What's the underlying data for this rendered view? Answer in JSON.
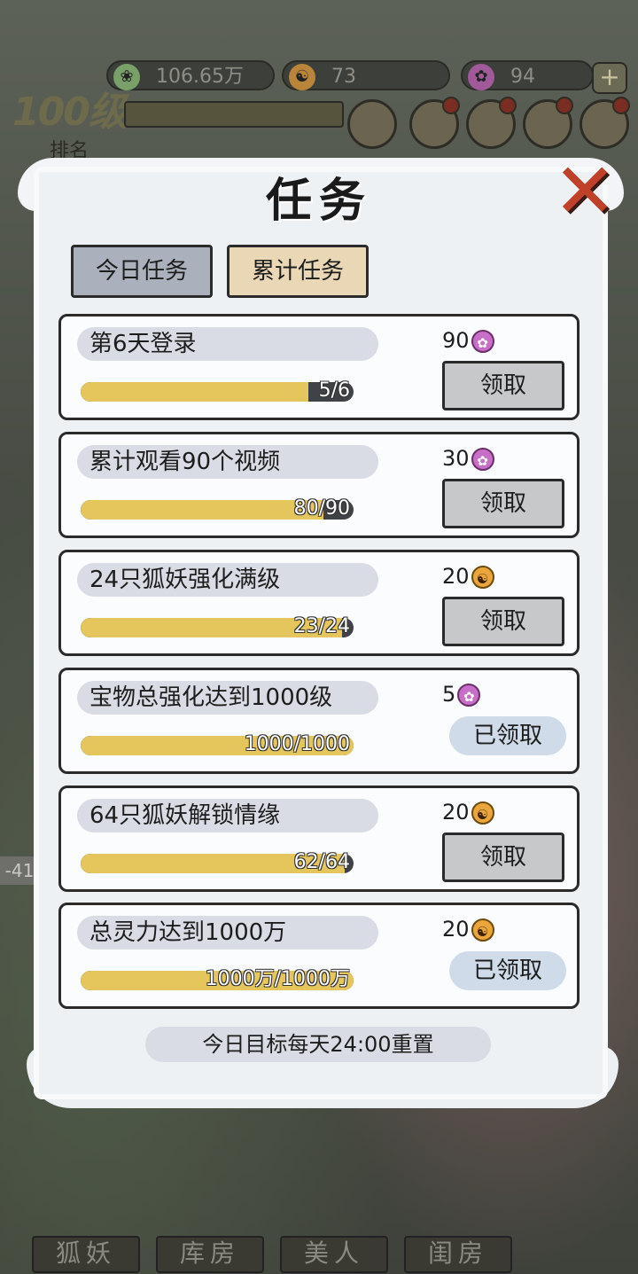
{
  "hud": {
    "spirit": "106.65万",
    "coins": "73",
    "gems": "94",
    "plus_label": "+",
    "level": "100级",
    "rank_label": "排名"
  },
  "panel": {
    "title": "任务",
    "close_label": "✕",
    "tabs": [
      {
        "label": "今日任务"
      },
      {
        "label": "累计任务"
      }
    ],
    "tasks": [
      {
        "title": "第6天登录",
        "progress_text": "5/6",
        "progress": 0.833,
        "reward_amount": "90",
        "reward_icon": "gem-icon",
        "button": "领取",
        "claimed": false
      },
      {
        "title": "累计观看90个视频",
        "progress_text": "80/90",
        "progress": 0.889,
        "reward_amount": "30",
        "reward_icon": "gem-icon",
        "button": "领取",
        "claimed": false
      },
      {
        "title": "24只狐妖强化满级",
        "progress_text": "23/24",
        "progress": 0.958,
        "reward_amount": "20",
        "reward_icon": "coin-icon",
        "button": "领取",
        "claimed": false
      },
      {
        "title": "宝物总强化达到1000级",
        "progress_text": "1000/1000",
        "progress": 1.0,
        "reward_amount": "5",
        "reward_icon": "gem-icon",
        "button": "已领取",
        "claimed": true
      },
      {
        "title": "64只狐妖解锁情缘",
        "progress_text": "62/64",
        "progress": 0.969,
        "reward_amount": "20",
        "reward_icon": "coin-icon",
        "button": "领取",
        "claimed": false
      },
      {
        "title": "总灵力达到1000万",
        "progress_text": "1000万/1000万",
        "progress": 1.0,
        "reward_amount": "20",
        "reward_icon": "coin-icon",
        "button": "已领取",
        "claimed": true
      }
    ],
    "footer_note": "今日目标每天24:00重置"
  },
  "nav": {
    "items": [
      {
        "label": "狐妖"
      },
      {
        "label": "库房"
      },
      {
        "label": "美人"
      },
      {
        "label": "闺房"
      }
    ]
  },
  "side_tag": "-41",
  "colors": {
    "progress_fill": "#e4c65c",
    "progress_track": "#3f4246",
    "tab_today": "#aab1bd",
    "tab_accumulated": "#e9d7b6",
    "close_red": "#c0402a"
  }
}
